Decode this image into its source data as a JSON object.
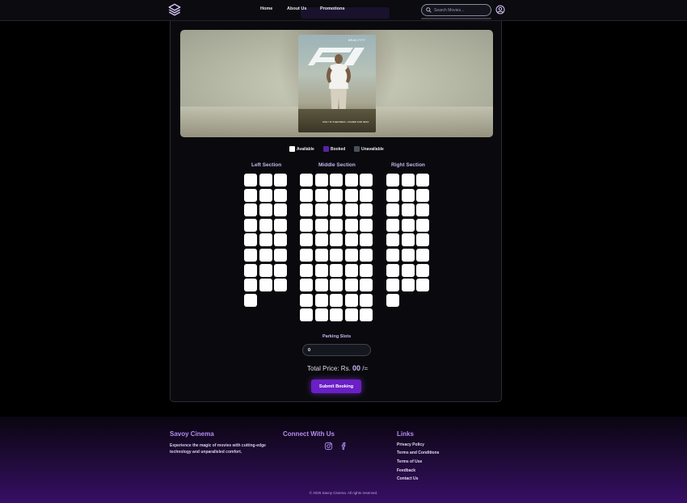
{
  "nav": {
    "links": [
      "Home",
      "About Us",
      "Promotions"
    ],
    "search_placeholder": "Search Movies..."
  },
  "poster": {
    "star": "BRAD PITT",
    "tagline": "ONLY IN THEATRES • FILMED FOR IMAX"
  },
  "legend": {
    "available": "Available",
    "booked": "Booked",
    "unavailable": "Unavailable",
    "colors": {
      "available": "#ffffff",
      "booked": "#5b1fa8",
      "unavailable": "#4a4f5c"
    }
  },
  "sections": {
    "left": {
      "title": "Left Section",
      "seats_per_row": [
        3,
        3,
        3,
        3,
        3,
        3,
        3,
        3,
        1
      ]
    },
    "middle": {
      "title": "Middle Section",
      "seats_per_row": [
        5,
        5,
        5,
        5,
        5,
        5,
        5,
        5,
        5,
        5
      ]
    },
    "right": {
      "title": "Right Section",
      "seats_per_row": [
        3,
        3,
        3,
        3,
        3,
        3,
        3,
        3,
        1
      ]
    }
  },
  "parking": {
    "label": "Parking Slots",
    "value": "0"
  },
  "total": {
    "prefix": "Total Price: Rs.",
    "amount": "00",
    "suffix": "/="
  },
  "submit_label": "Submit Booking",
  "footer": {
    "brand_title": "Savoy Cinema",
    "brand_desc": "Experience the magic of movies with cutting-edge technology and unparalleled comfort.",
    "connect_title": "Connect With Us",
    "links_title": "Links",
    "links": [
      "Privacy Policy",
      "Terms and Conditions",
      "Terms of Use",
      "Feedback",
      "Contact Us"
    ],
    "copyright": "© 2025 Savoy Cinema. All rights reserved."
  }
}
